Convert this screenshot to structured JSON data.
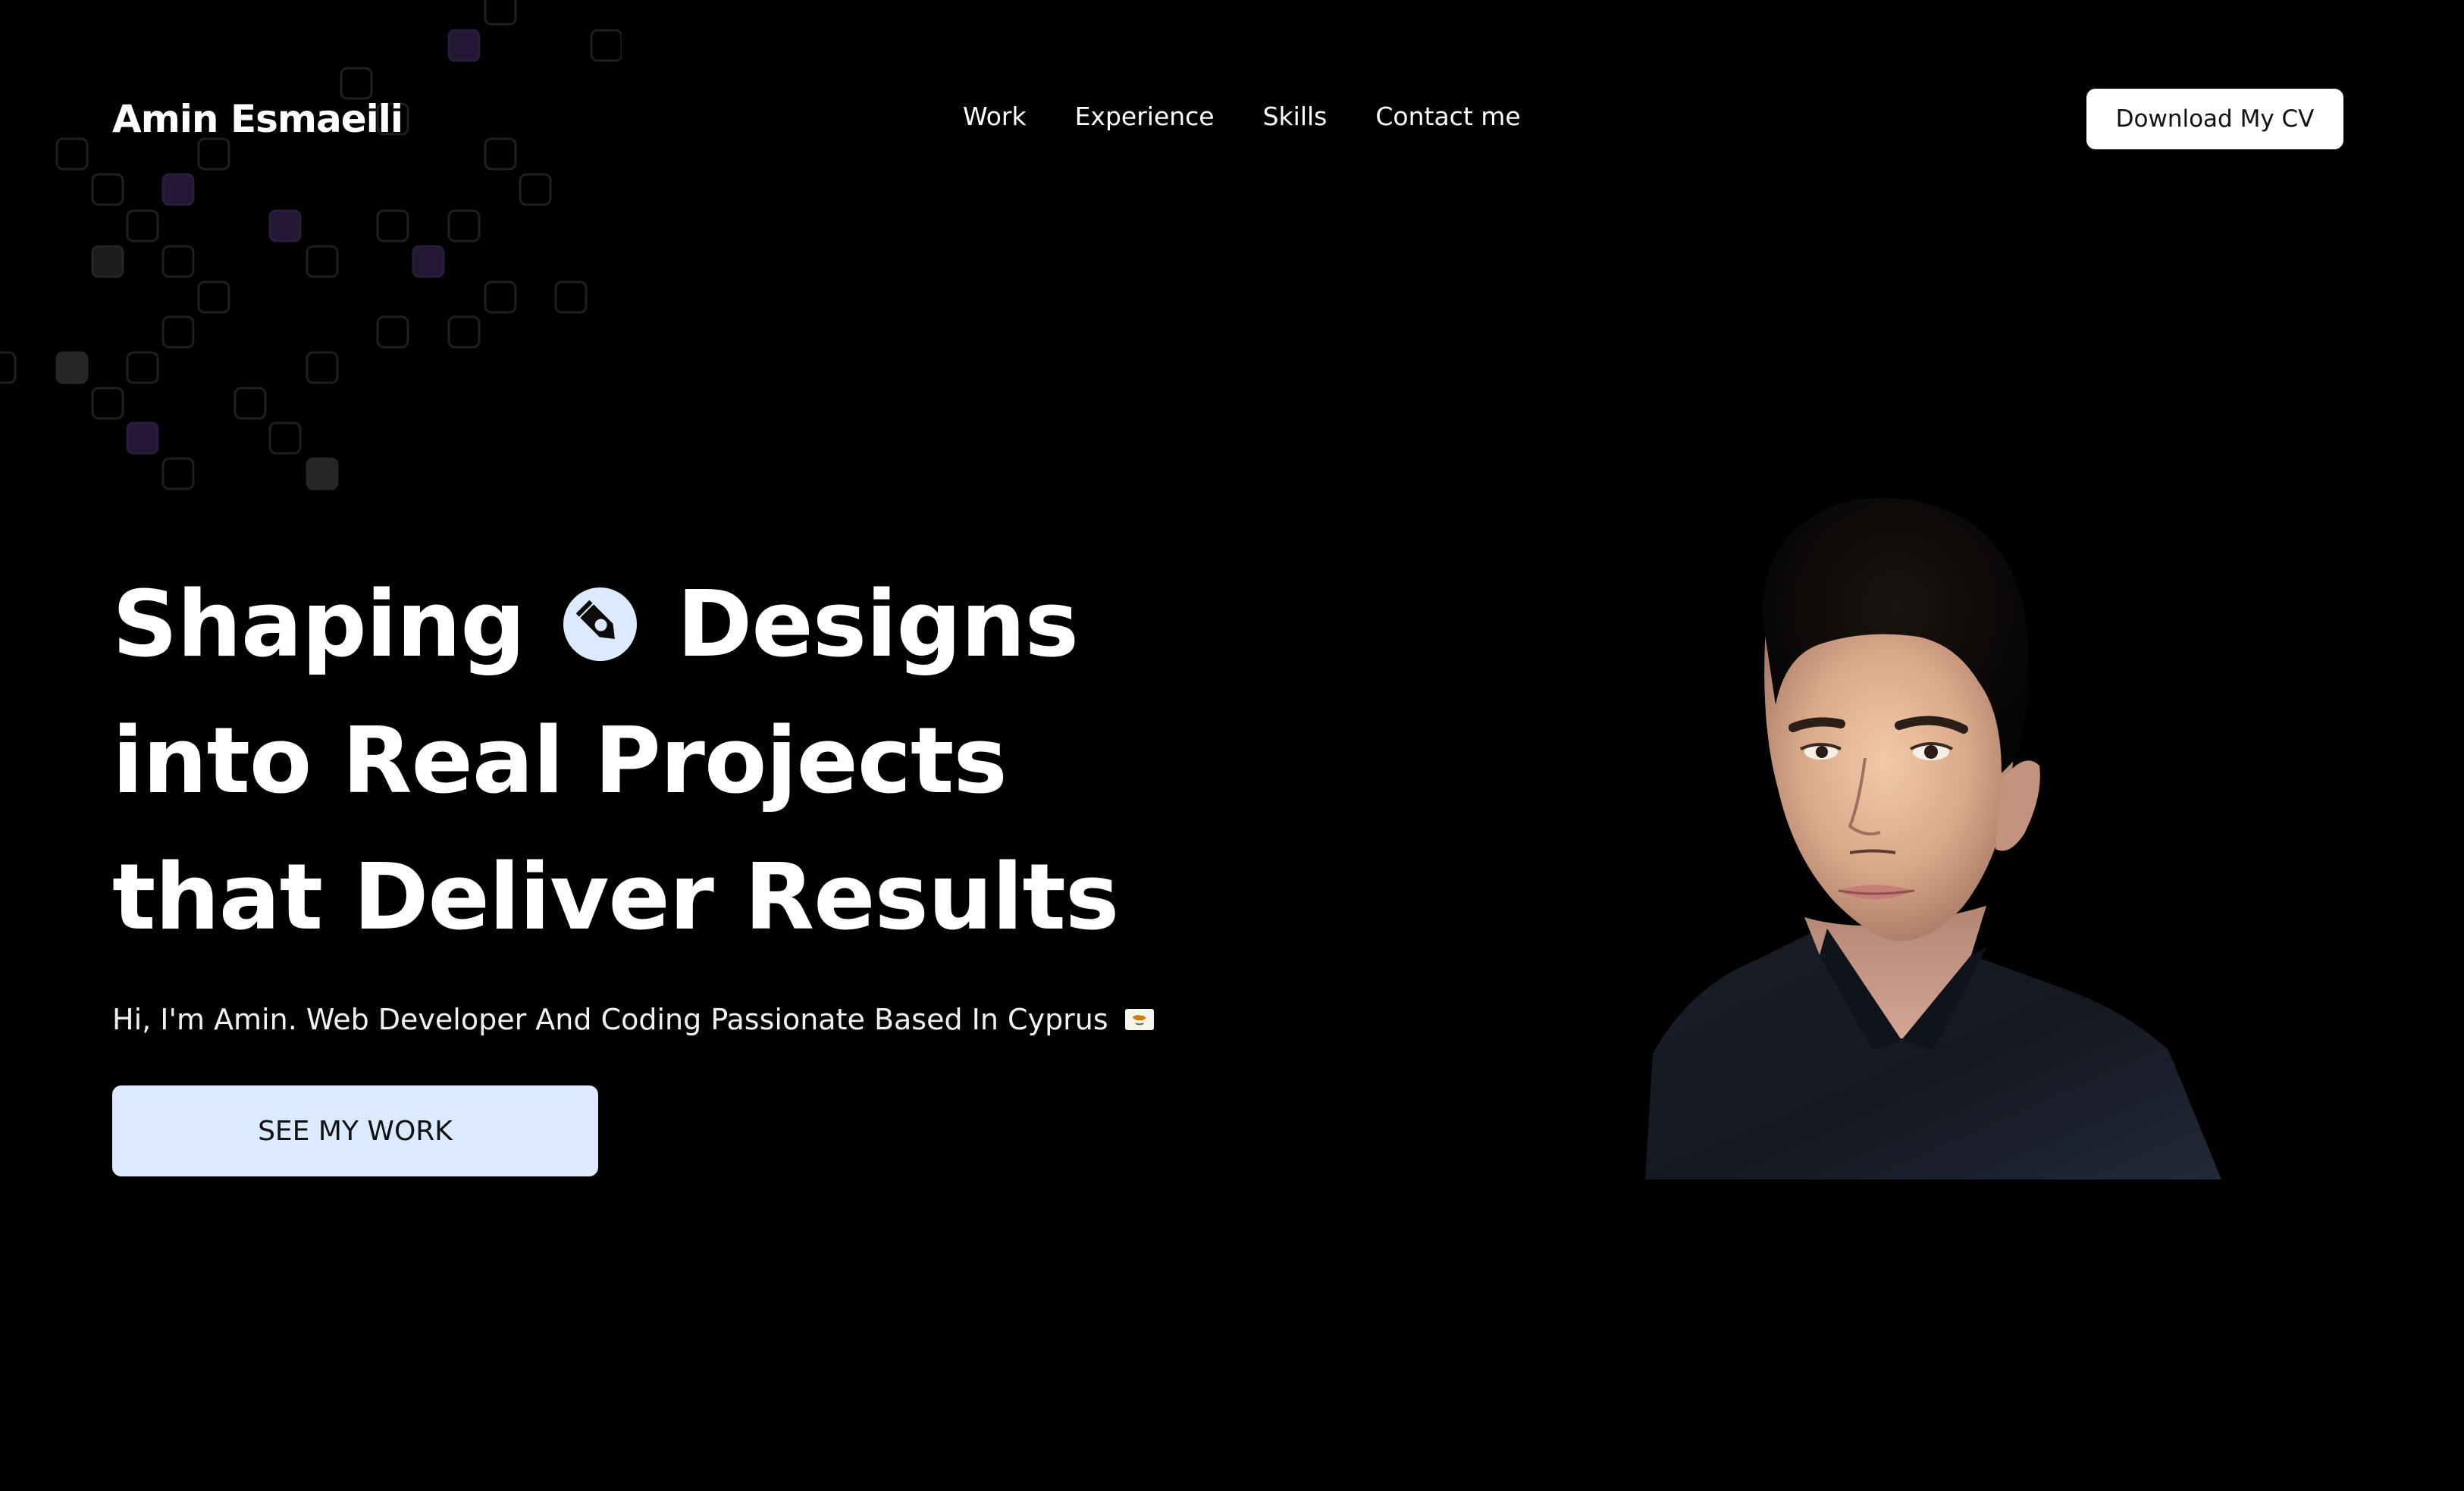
{
  "header": {
    "logo": "Amin Esmaeili",
    "nav": [
      {
        "label": "Work"
      },
      {
        "label": "Experience"
      },
      {
        "label": "Skills"
      },
      {
        "label": "Contact me"
      }
    ],
    "cv_button": "Download My CV"
  },
  "hero": {
    "title_line1_part1": "Shaping",
    "title_line1_part2": "Designs",
    "title_line2": "into Real Projects",
    "title_line3": "that Deliver Results",
    "title_icon": "pen-tool-icon",
    "subtitle": "Hi, I'm Amin. Web Developer And Coding Passionate Based In Cyprus",
    "subtitle_icon": "cyprus-flag-icon",
    "cta_button": "SEE MY WORK",
    "portrait": "portrait-image"
  },
  "colors": {
    "background": "#000000",
    "accent": "#dbeafe",
    "text": "#ffffff"
  }
}
